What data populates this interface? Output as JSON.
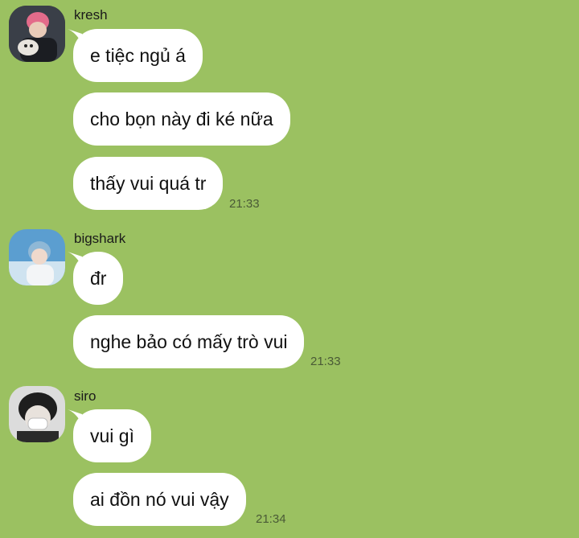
{
  "chat": {
    "background_color": "#9bc161",
    "groups": [
      {
        "sender": "kresh",
        "avatar_icon": "kresh-avatar",
        "messages": [
          "e tiệc ngủ á",
          "cho bọn này đi ké nữa",
          "thấy vui quá tr"
        ],
        "time": "21:33"
      },
      {
        "sender": "bigshark",
        "avatar_icon": "bigshark-avatar",
        "messages": [
          "đr",
          "nghe bảo có mấy trò vui"
        ],
        "time": "21:33"
      },
      {
        "sender": "siro",
        "avatar_icon": "siro-avatar",
        "messages": [
          "vui gì",
          "ai đồn nó vui vậy"
        ],
        "time": "21:34"
      }
    ]
  }
}
